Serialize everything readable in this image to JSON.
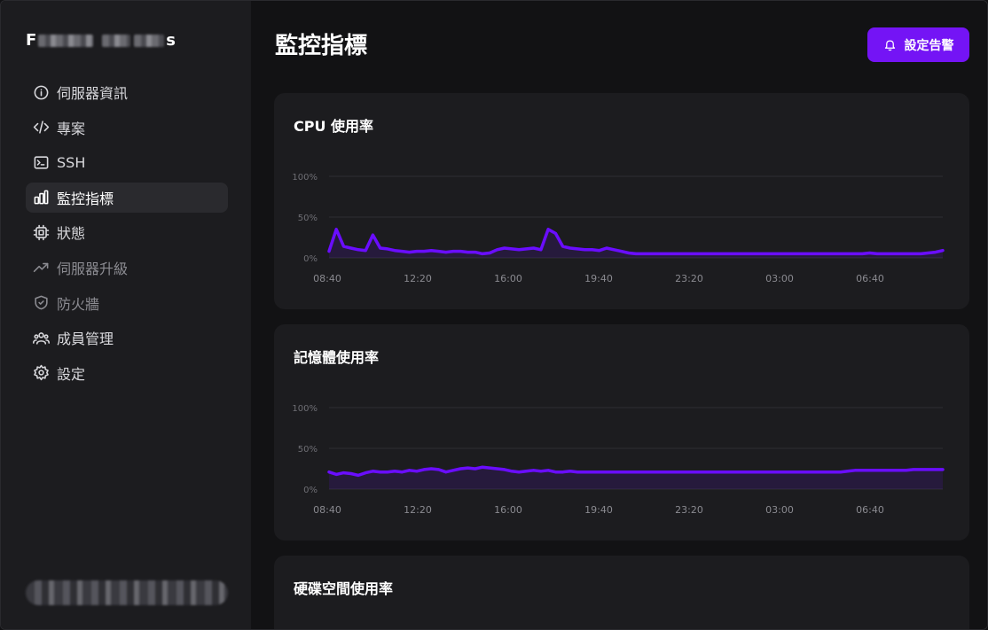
{
  "sidebar": {
    "brand_first": "F",
    "brand_last": "s",
    "items": [
      {
        "label": "伺服器資訊",
        "icon": "info-icon",
        "state": "normal"
      },
      {
        "label": "專案",
        "icon": "code-icon",
        "state": "normal"
      },
      {
        "label": "SSH",
        "icon": "terminal-icon",
        "state": "normal"
      },
      {
        "label": "監控指標",
        "icon": "bar-chart-icon",
        "state": "active"
      },
      {
        "label": "狀態",
        "icon": "cpu-icon",
        "state": "normal"
      },
      {
        "label": "伺服器升級",
        "icon": "trending-up-icon",
        "state": "dim"
      },
      {
        "label": "防火牆",
        "icon": "shield-check-icon",
        "state": "dim"
      },
      {
        "label": "成員管理",
        "icon": "users-icon",
        "state": "normal"
      },
      {
        "label": "設定",
        "icon": "gear-icon",
        "state": "normal"
      }
    ]
  },
  "header": {
    "title": "監控指標",
    "alert_button": "設定告警"
  },
  "colors": {
    "accent": "#7414f5",
    "line": "#6a0dff",
    "grid": "#2e2e33"
  },
  "chart_data": [
    {
      "type": "area",
      "title": "CPU 使用率",
      "x_ticks": [
        "08:40",
        "12:20",
        "16:00",
        "19:40",
        "23:20",
        "03:00",
        "06:40"
      ],
      "y_ticks": [
        "100%",
        "50%",
        "0%"
      ],
      "ylim": [
        0,
        100
      ],
      "x": [
        0,
        1,
        2,
        3,
        4,
        5,
        6,
        7,
        8,
        9,
        10,
        11,
        12,
        13,
        14,
        15,
        16,
        17,
        18,
        19,
        20,
        21,
        22,
        23,
        24,
        25,
        26,
        27,
        28,
        29,
        30,
        31,
        32,
        33,
        34,
        35,
        36,
        37,
        38,
        39,
        40,
        41,
        42,
        43,
        44,
        45,
        46,
        47,
        48,
        49,
        50,
        51,
        52,
        53,
        54,
        55,
        56,
        57,
        58,
        59,
        60,
        61,
        62,
        63,
        64,
        65,
        66,
        67,
        68,
        69,
        70,
        71,
        72,
        73,
        74,
        75,
        76,
        77,
        78,
        79,
        80,
        81,
        82,
        83,
        84
      ],
      "values": [
        8,
        35,
        14,
        12,
        10,
        9,
        28,
        12,
        11,
        9,
        8,
        7,
        8,
        8,
        9,
        8,
        7,
        8,
        8,
        7,
        7,
        5,
        6,
        10,
        12,
        11,
        10,
        11,
        12,
        10,
        35,
        30,
        14,
        12,
        11,
        10,
        10,
        9,
        12,
        10,
        8,
        6,
        5,
        5,
        5,
        5,
        5,
        5,
        5,
        5,
        5,
        5,
        5,
        5,
        5,
        5,
        5,
        5,
        5,
        5,
        5,
        5,
        5,
        5,
        5,
        5,
        5,
        5,
        5,
        5,
        5,
        5,
        5,
        5,
        6,
        5,
        5,
        5,
        5,
        5,
        5,
        5,
        6,
        7,
        9
      ],
      "grid": true
    },
    {
      "type": "area",
      "title": "記憶體使用率",
      "x_ticks": [
        "08:40",
        "12:20",
        "16:00",
        "19:40",
        "23:20",
        "03:00",
        "06:40"
      ],
      "y_ticks": [
        "100%",
        "50%",
        "0%"
      ],
      "ylim": [
        0,
        100
      ],
      "x": [
        0,
        1,
        2,
        3,
        4,
        5,
        6,
        7,
        8,
        9,
        10,
        11,
        12,
        13,
        14,
        15,
        16,
        17,
        18,
        19,
        20,
        21,
        22,
        23,
        24,
        25,
        26,
        27,
        28,
        29,
        30,
        31,
        32,
        33,
        34,
        35,
        36,
        37,
        38,
        39,
        40,
        41,
        42,
        43,
        44,
        45,
        46,
        47,
        48,
        49,
        50,
        51,
        52,
        53,
        54,
        55,
        56,
        57,
        58,
        59,
        60,
        61,
        62,
        63,
        64,
        65,
        66,
        67,
        68,
        69,
        70,
        71,
        72,
        73,
        74,
        75,
        76,
        77,
        78,
        79,
        80,
        81,
        82,
        83,
        84
      ],
      "values": [
        21,
        18,
        20,
        19,
        17,
        20,
        22,
        21,
        21,
        22,
        21,
        23,
        22,
        24,
        25,
        24,
        21,
        23,
        25,
        26,
        25,
        27,
        26,
        25,
        24,
        22,
        21,
        22,
        23,
        22,
        23,
        21,
        21,
        22,
        21,
        21,
        21,
        21,
        21,
        21,
        21,
        21,
        21,
        21,
        21,
        21,
        21,
        21,
        21,
        21,
        21,
        21,
        21,
        21,
        21,
        21,
        21,
        21,
        21,
        21,
        21,
        21,
        21,
        21,
        21,
        21,
        21,
        21,
        21,
        21,
        21,
        22,
        23,
        23,
        23,
        23,
        23,
        23,
        23,
        23,
        24,
        24,
        24,
        24,
        24
      ],
      "grid": true
    },
    {
      "type": "area",
      "title": "硬碟空間使用率"
    }
  ]
}
